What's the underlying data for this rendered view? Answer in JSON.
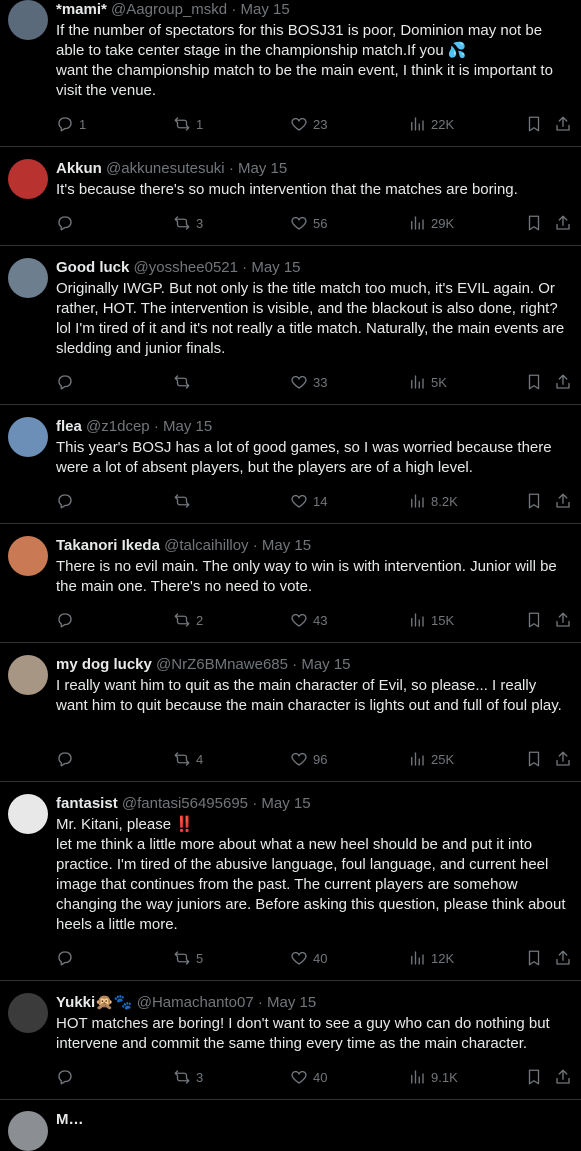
{
  "tweets": [
    {
      "name": "*mami*",
      "handle": "@Aagroup_mskd",
      "date": "May 15",
      "text": "If the number of spectators for this BOSJ31 is poor, Dominion may not be able to take center stage in the championship match.If you 💦\nwant the championship match to be the main event, I think it is important to visit the venue.",
      "replies": "1",
      "retweets": "1",
      "likes": "23",
      "views": "22K",
      "avatar_color": "#5b6a7a"
    },
    {
      "name": "Akkun",
      "handle": "@akkunesutesuki",
      "date": "May 15",
      "text": "It's because there's so much intervention that the matches are boring.",
      "replies": "",
      "retweets": "3",
      "likes": "56",
      "views": "29K",
      "avatar_color": "#b8322f"
    },
    {
      "name": "Good luck",
      "handle": "@yosshee0521",
      "date": "May 15",
      "text": "Originally IWGP. But not only is the title match too much, it's EVIL again. Or rather, HOT. The intervention is visible, and the blackout is also done, right? lol I'm tired of it and it's not really a title match. Naturally, the main events are sledding and junior finals.",
      "replies": "",
      "retweets": "",
      "likes": "33",
      "views": "5K",
      "avatar_color": "#6d7e8f"
    },
    {
      "name": "flea",
      "handle": "@z1dcep",
      "date": "May 15",
      "text": "This year's BOSJ has a lot of good games, so I was worried because there were a lot of absent players, but the players are of a high level.",
      "replies": "",
      "retweets": "",
      "likes": "14",
      "views": "8.2K",
      "avatar_color": "#6c8fb8"
    },
    {
      "name": "Takanori Ikeda",
      "handle": "@talcaihilloy",
      "date": "May 15",
      "text": "There is no evil main. The only way to win is with intervention. Junior will be the main one. There's no need to vote.",
      "replies": "",
      "retweets": "2",
      "likes": "43",
      "views": "15K",
      "avatar_color": "#c97a55"
    },
    {
      "name": "my dog lucky",
      "handle": "@NrZ6BMnawe685",
      "date": "May 15",
      "text": "I really want him to quit as the main character of Evil, so please... I really want him to quit because the main character is lights out and full of foul play.",
      "replies": "",
      "retweets": "4",
      "likes": "96",
      "views": "25K",
      "avatar_color": "#a89684"
    },
    {
      "name": "fantasist",
      "handle": "@fantasi56495695",
      "date": "May 15",
      "text": "Mr. Kitani, please ‼️\nlet me think a little more about what a new heel should be and put it into practice. I'm tired of the abusive language, foul language, and current heel image that continues from the past. The current players are somehow changing the way juniors are. Before asking this question, please think about heels a little more.",
      "replies": "",
      "retweets": "5",
      "likes": "40",
      "views": "12K",
      "avatar_color": "#e8e8e8"
    },
    {
      "name": "Yukki🙊🐾",
      "handle": "@Hamachanto07",
      "date": "May 15",
      "text": "HOT matches are boring! I don't want to see a guy who can do nothing but intervene and commit the same thing every time as the main character.",
      "replies": "",
      "retweets": "3",
      "likes": "40",
      "views": "9.1K",
      "avatar_color": "#3b3b3b"
    }
  ],
  "partial": {
    "text": "M…"
  }
}
